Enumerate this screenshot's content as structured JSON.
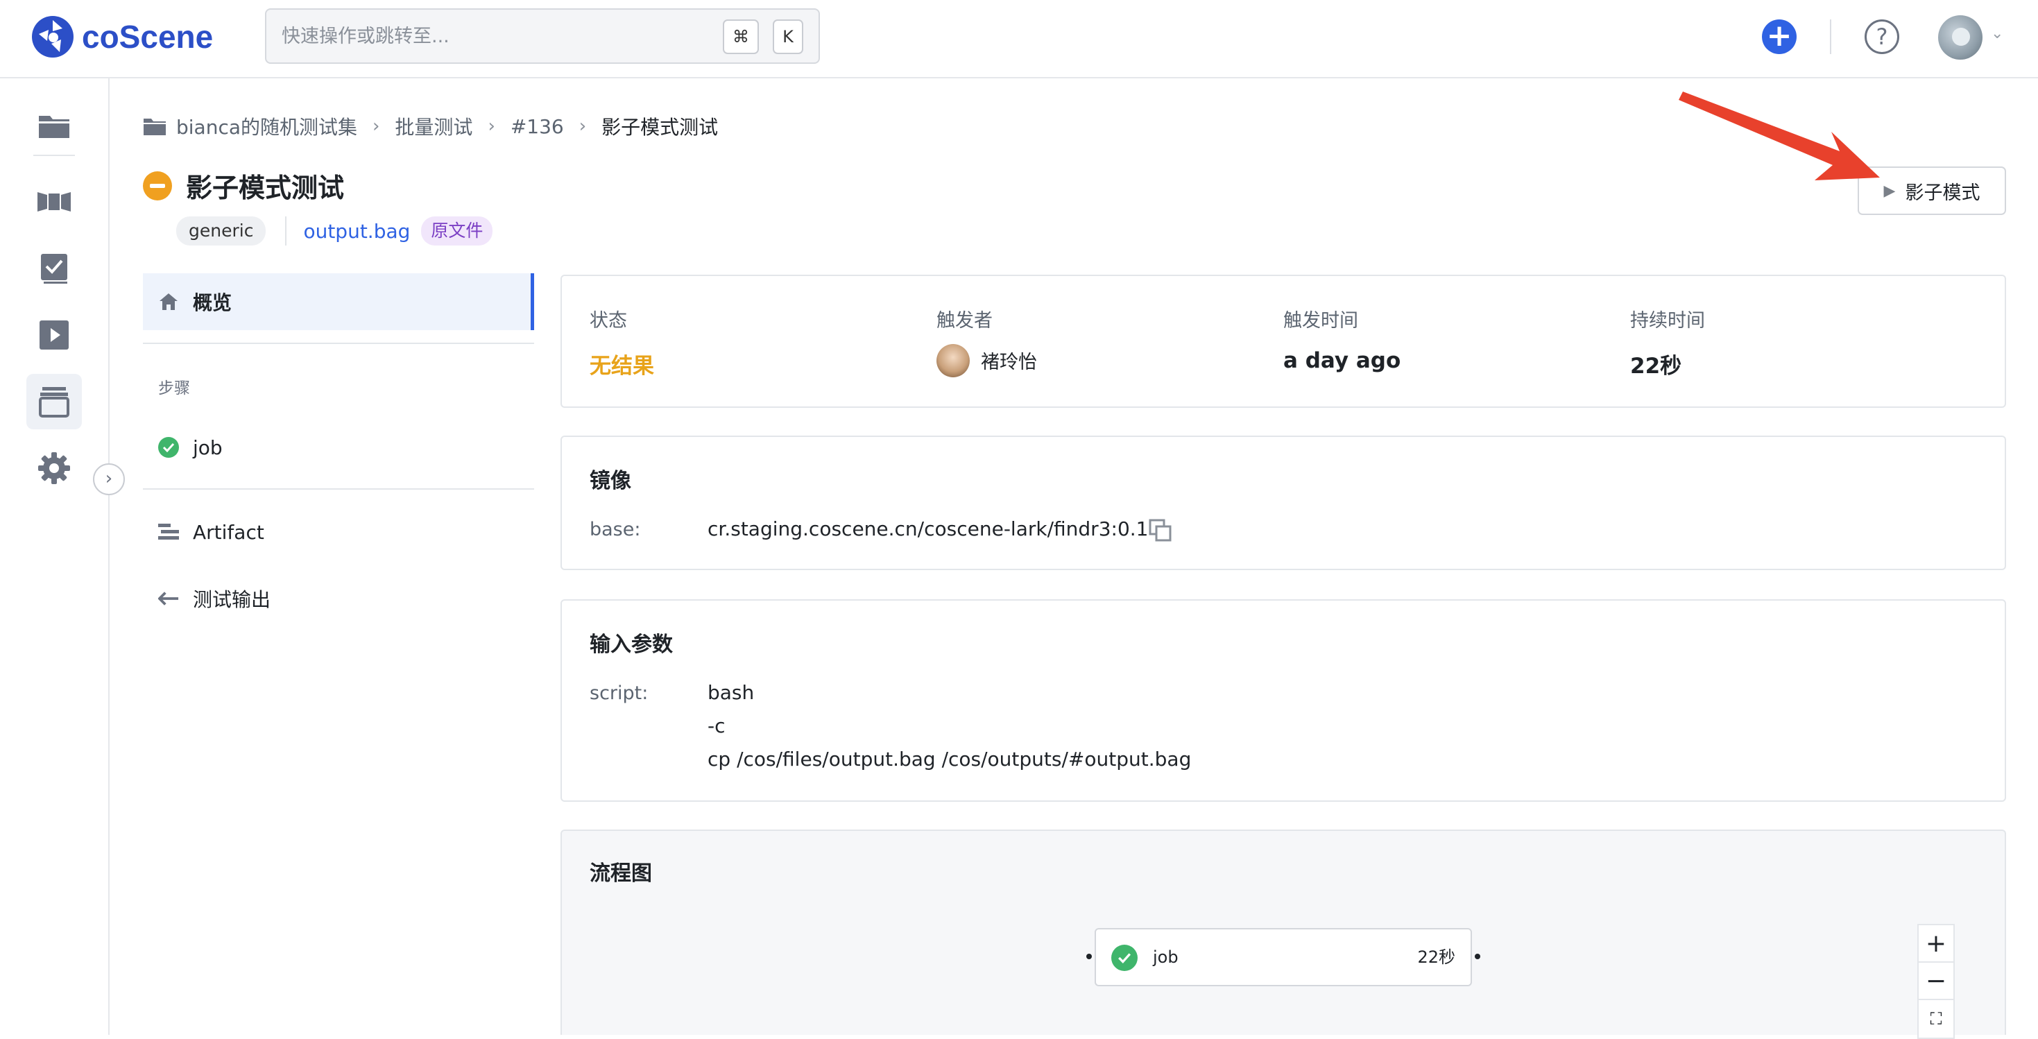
{
  "app": {
    "logo_text": "coScene"
  },
  "search": {
    "placeholder": "快速操作或跳转至...",
    "shortcut_cmd": "⌘",
    "shortcut_key": "K"
  },
  "header_actions": {
    "add_label": "+",
    "help_label": "?"
  },
  "breadcrumb": [
    "bianca的随机测试集",
    "批量测试",
    "#136",
    "影子模式测试"
  ],
  "page": {
    "title": "影子模式测试",
    "status_color": "#f0a020"
  },
  "tags": {
    "generic": "generic",
    "file": "output.bag",
    "raw": "原文件"
  },
  "shadow_button": {
    "label": "影子模式"
  },
  "nav": {
    "overview": "概览",
    "steps_group": "步骤",
    "job": "job",
    "artifact": "Artifact",
    "test_output": "测试输出"
  },
  "summary": {
    "status_label": "状态",
    "status_value": "无结果",
    "trigger_label": "触发者",
    "trigger_value": "褚玲怡",
    "time_label": "触发时间",
    "time_value": "a day ago",
    "duration_label": "持续时间",
    "duration_value": "22秒"
  },
  "image": {
    "title": "镜像",
    "base_label": "base:",
    "base_value": "cr.staging.coscene.cn/coscene-lark/findr3:0.1"
  },
  "params": {
    "title": "输入参数",
    "script_label": "script:",
    "script_lines": [
      "bash",
      "-c",
      "cp /cos/files/output.bag /cos/outputs/#output.bag"
    ]
  },
  "flow": {
    "title": "流程图",
    "node_label": "job",
    "node_duration": "22秒",
    "zoom_in": "+",
    "zoom_out": "−",
    "fit": "⛶"
  },
  "colors": {
    "brand": "#2c4fc7",
    "accent": "#2f62e3",
    "success": "#3fb56b",
    "warning": "#e8a31a",
    "annotation": "#e8412c"
  },
  "icons": [
    "logo-icon",
    "folder-icon",
    "dataset-icon",
    "task-icon",
    "play-icon",
    "records-icon",
    "gear-icon",
    "home-icon",
    "check-circle-icon",
    "artifact-icon",
    "arrow-left-icon",
    "copy-icon",
    "help-icon",
    "plus-icon",
    "chevron-right-icon",
    "chevron-down-icon"
  ]
}
